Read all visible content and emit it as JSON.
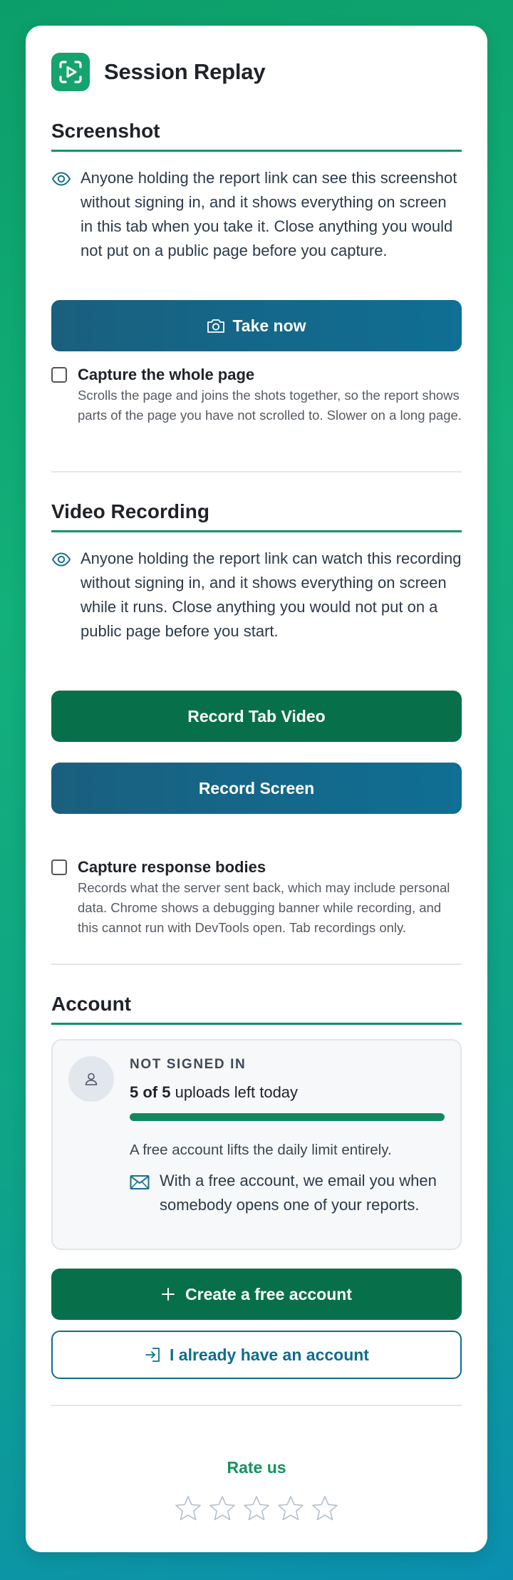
{
  "app": {
    "title": "Session Replay"
  },
  "screenshot": {
    "section_title": "Screenshot",
    "notice": "Anyone holding the report link can see this screenshot without signing in, and it shows everything on screen in this tab when you take it. Close anything you would not put on a public page before you capture.",
    "take_now_label": "Take now",
    "whole_page": {
      "title": "Capture the whole page",
      "description": "Scrolls the page and joins the shots together, so the report shows parts of the page you have not scrolled to. Slower on a long page.",
      "checked": false
    }
  },
  "video": {
    "section_title": "Video Recording",
    "notice": "Anyone holding the report link can watch this recording without signing in, and it shows everything on screen while it runs. Close anything you would not put on a public page before you start.",
    "record_tab_label": "Record Tab Video",
    "record_screen_label": "Record Screen",
    "response_bodies": {
      "title": "Capture response bodies",
      "description": "Records what the server sent back, which may include personal data. Chrome shows a debugging banner while recording, and this cannot run with DevTools open. Tab recordings only.",
      "checked": false
    }
  },
  "account": {
    "section_title": "Account",
    "status": "NOT SIGNED IN",
    "uploads_count": "5 of 5",
    "uploads_suffix": " uploads left today",
    "uploads_remaining_fraction": 1.0,
    "limit_note": "A free account lifts the daily limit entirely.",
    "email_note": "With a free account, we email you when somebody opens one of your reports.",
    "create_label": "Create a free account",
    "signin_label": "I already have an account"
  },
  "rating": {
    "title": "Rate us",
    "stars_total": 5,
    "stars_selected": 0
  },
  "colors": {
    "brand_green": "#16a36d",
    "button_blue": "#0f6f94",
    "button_green": "#07704b",
    "accent_rule": "#12946a"
  }
}
